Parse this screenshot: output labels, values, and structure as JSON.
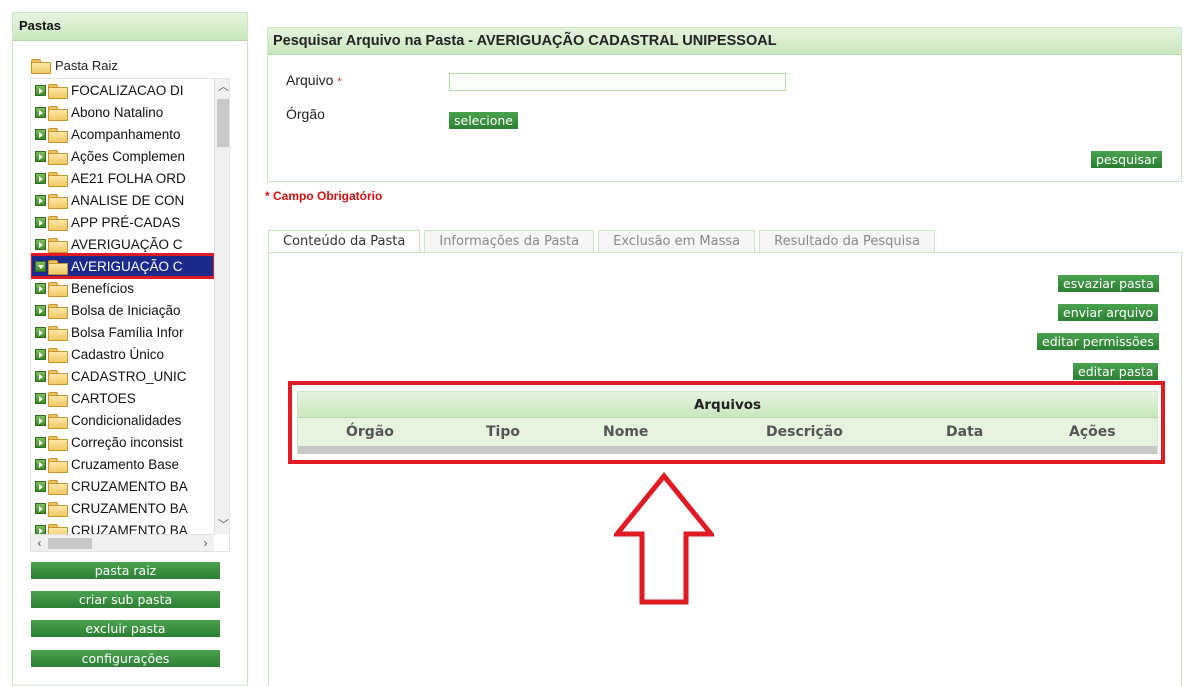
{
  "left": {
    "title": "Pastas",
    "root": "Pasta Raiz",
    "tree": [
      {
        "label": "FOCALIZACAO DI",
        "selected": false
      },
      {
        "label": "Abono Natalino",
        "selected": false
      },
      {
        "label": "Acompanhamento",
        "selected": false
      },
      {
        "label": "Ações Complemen",
        "selected": false
      },
      {
        "label": "AE21 FOLHA ORD",
        "selected": false
      },
      {
        "label": "ANALISE DE CON",
        "selected": false
      },
      {
        "label": "APP PRÉ-CADAS",
        "selected": false
      },
      {
        "label": "AVERIGUAÇÃO C",
        "selected": false
      },
      {
        "label": "AVERIGUAÇÃO C",
        "selected": true
      },
      {
        "label": "Benefícios",
        "selected": false
      },
      {
        "label": "Bolsa de Iniciação",
        "selected": false
      },
      {
        "label": "Bolsa Família Infor",
        "selected": false
      },
      {
        "label": "Cadastro Único",
        "selected": false
      },
      {
        "label": "CADASTRO_UNIC",
        "selected": false
      },
      {
        "label": "CARTOES",
        "selected": false
      },
      {
        "label": "Condicionalidades",
        "selected": false
      },
      {
        "label": "Correção inconsist",
        "selected": false
      },
      {
        "label": "Cruzamento Base",
        "selected": false
      },
      {
        "label": "CRUZAMENTO BA",
        "selected": false
      },
      {
        "label": "CRUZAMENTO BA",
        "selected": false
      },
      {
        "label": "CRUZAMENTO BA",
        "selected": false
      }
    ],
    "buttons": {
      "root": "pasta raiz",
      "create_sub": "criar sub pasta",
      "delete": "excluir pasta",
      "settings": "configurações"
    }
  },
  "search": {
    "title": "Pesquisar Arquivo na Pasta - AVERIGUAÇÃO CADASTRAL UNIPESSOAL",
    "file_label": "Arquivo",
    "required_mark": "*",
    "file_value": "",
    "org_label": "Órgão",
    "select_button": "selecione",
    "search_button": "pesquisar"
  },
  "required_note": "* Campo Obrigatório",
  "tabs": [
    {
      "label": "Conteúdo da Pasta",
      "active": true
    },
    {
      "label": "Informações da Pasta",
      "active": false
    },
    {
      "label": "Exclusão em Massa",
      "active": false
    },
    {
      "label": "Resultado da Pesquisa",
      "active": false
    }
  ],
  "actions": {
    "empty_folder": "esvaziar pasta",
    "send_file": "enviar arquivo",
    "edit_permissions": "editar permissões",
    "edit_folder": "editar pasta"
  },
  "files": {
    "caption": "Arquivos",
    "columns": [
      "Órgão",
      "Tipo",
      "Nome",
      "Descrição",
      "Data",
      "Ações"
    ]
  },
  "colors": {
    "accent_green": "#2c7f33",
    "header_green": "#c9e7bd",
    "highlight_red": "#e01b24",
    "selected_blue": "#1c2a8c"
  }
}
